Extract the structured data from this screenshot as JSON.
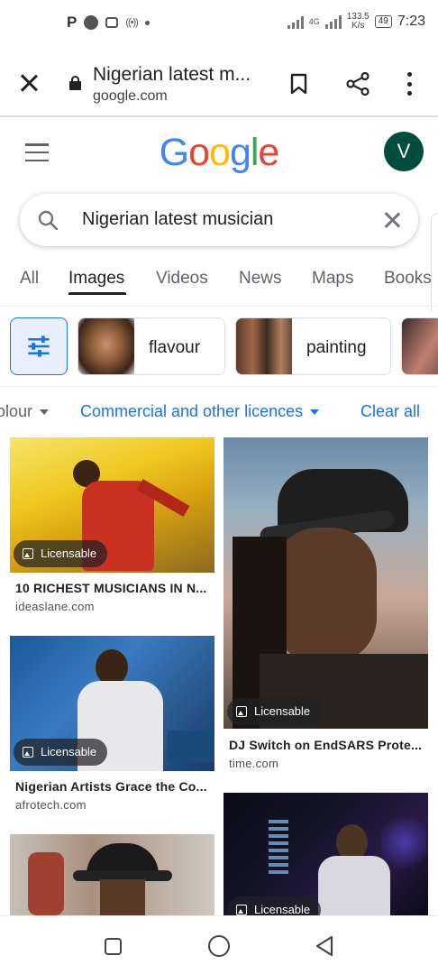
{
  "status_bar": {
    "left_letter": "P",
    "network": "4G",
    "speed": "133.5",
    "speed_unit": "K/s",
    "battery": "49",
    "time": "7:23"
  },
  "tab_bar": {
    "title": "Nigerian latest m...",
    "url": "google.com"
  },
  "header": {
    "logo_letters": [
      {
        "ch": "G",
        "color": "#4285F4"
      },
      {
        "ch": "o",
        "color": "#EA4335"
      },
      {
        "ch": "o",
        "color": "#FBBC05"
      },
      {
        "ch": "g",
        "color": "#4285F4"
      },
      {
        "ch": "l",
        "color": "#34A853"
      },
      {
        "ch": "e",
        "color": "#EA4335"
      }
    ],
    "avatar_letter": "V"
  },
  "search": {
    "query": "Nigerian latest musician"
  },
  "tabs": [
    "All",
    "Images",
    "Videos",
    "News",
    "Maps",
    "Books"
  ],
  "active_tab": "Images",
  "chips": [
    "flavour",
    "painting"
  ],
  "filters": {
    "colour": "olour",
    "licence": "Commercial and other licences",
    "clear": "Clear all"
  },
  "results": [
    {
      "badge": "Licensable",
      "title": "10 RICHEST MUSICIANS IN N...",
      "source": "ideaslane.com"
    },
    {
      "badge": "Licensable",
      "title": "DJ Switch on EndSARS Prote...",
      "source": "time.com"
    },
    {
      "badge": "Licensable",
      "title": "Nigerian Artists Grace the Co...",
      "source": "afrotech.com"
    },
    {
      "badge": "Licensable",
      "title": "",
      "source": ""
    }
  ],
  "colors": {
    "accent": "#1a73e8",
    "avatar_bg": "#004d40"
  }
}
